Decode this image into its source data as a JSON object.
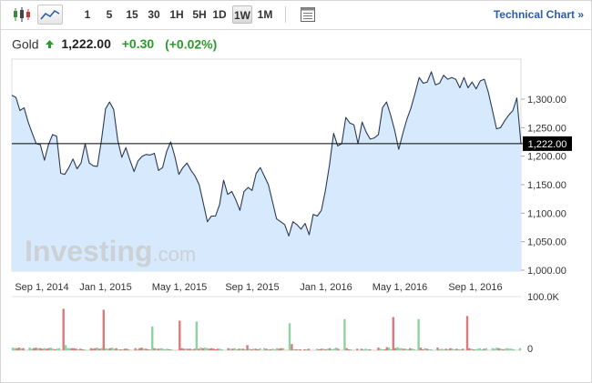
{
  "toolbar": {
    "chart_type_icons": [
      "candlestick-icon",
      "line-chart-icon"
    ],
    "timeframes": [
      {
        "label": "1",
        "active": false
      },
      {
        "label": "5",
        "active": false
      },
      {
        "label": "15",
        "active": false
      },
      {
        "label": "30",
        "active": false
      },
      {
        "label": "1H",
        "active": false
      },
      {
        "label": "5H",
        "active": false
      },
      {
        "label": "1D",
        "active": false
      },
      {
        "label": "1W",
        "active": true
      },
      {
        "label": "1M",
        "active": false
      }
    ],
    "table_icon": "table-icon",
    "technical_chart_label": "Technical Chart »"
  },
  "quote": {
    "name": "Gold",
    "direction_icon": "up-arrow-icon",
    "price": "1,222.00",
    "change": "+0.30",
    "change_pct": "(+0.02%)",
    "positive_color": "#2c9a2c"
  },
  "watermark": {
    "brand": "Investing",
    "suffix": ".com"
  },
  "colors": {
    "line": "#2b3a55",
    "area_fill": "#d7e9fc",
    "current_price_line": "#000000",
    "current_price_label_bg": "#000000",
    "volume_up": "#8fd0a5",
    "volume_down": "#d97b7b"
  },
  "chart_data": {
    "type": "area",
    "title": "",
    "xlabel": "",
    "ylabel": "",
    "x_tick_labels": [
      "Sep 1, 2014",
      "Jan 1, 2015",
      "May 1, 2015",
      "Sep 1, 2015",
      "Jan 1, 2016",
      "May 1, 2016",
      "Sep 1, 2016"
    ],
    "y_tick_labels": [
      "1,000.00",
      "1,050.00",
      "1,100.00",
      "1,150.00",
      "1,200.00",
      "1,250.00",
      "1,300.00"
    ],
    "ylim": [
      1000,
      1350
    ],
    "grid": false,
    "current_price": 1222,
    "current_price_label": "1,222.00",
    "series": [
      {
        "values": [
          1307,
          1303,
          1280,
          1285,
          1260,
          1240,
          1222,
          1220,
          1193,
          1220,
          1238,
          1235,
          1170,
          1168,
          1180,
          1195,
          1178,
          1188,
          1222,
          1188,
          1183,
          1182,
          1228,
          1283,
          1295,
          1282,
          1228,
          1198,
          1215,
          1193,
          1173,
          1192,
          1200,
          1203,
          1202,
          1205,
          1175,
          1180,
          1208,
          1225,
          1200,
          1168,
          1180,
          1188,
          1175,
          1165,
          1150,
          1118,
          1085,
          1095,
          1095,
          1115,
          1158,
          1133,
          1138,
          1123,
          1105,
          1138,
          1145,
          1140,
          1170,
          1180,
          1165,
          1150,
          1120,
          1090,
          1085,
          1080,
          1060,
          1085,
          1080,
          1072,
          1082,
          1062,
          1098,
          1095,
          1105,
          1140,
          1185,
          1240,
          1218,
          1222,
          1268,
          1258,
          1255,
          1222,
          1260,
          1242,
          1230,
          1232,
          1238,
          1285,
          1295,
          1272,
          1245,
          1212,
          1240,
          1265,
          1285,
          1310,
          1338,
          1328,
          1330,
          1348,
          1325,
          1328,
          1342,
          1335,
          1338,
          1335,
          1320,
          1338,
          1320,
          1330,
          1318,
          1332,
          1335,
          1312,
          1280,
          1248,
          1250,
          1262,
          1272,
          1280,
          1302,
          1222
        ]
      }
    ],
    "volume": {
      "axis_labels": [
        "100.0K",
        "0"
      ],
      "ylim": [
        0,
        100
      ],
      "values": [
        5,
        4,
        4,
        5,
        4,
        4,
        0,
        0,
        5,
        3,
        4,
        5,
        4,
        4,
        3,
        4,
        3,
        4,
        5,
        3,
        2,
        3,
        4,
        0,
        80,
        10,
        4,
        4,
        4,
        4,
        3,
        2,
        3,
        2,
        2,
        0,
        0,
        4,
        3,
        4,
        5,
        3,
        4,
        78,
        4,
        3,
        4,
        5,
        3,
        4,
        2,
        2,
        2,
        3,
        3,
        2,
        0,
        0,
        4,
        2,
        4,
        5,
        3,
        3,
        2,
        2,
        46,
        4,
        3,
        3,
        4,
        3,
        2,
        3,
        2,
        2,
        0,
        0,
        0,
        57,
        4,
        3,
        3,
        3,
        3,
        2,
        3,
        55,
        3,
        5,
        4,
        5,
        4,
        3,
        4,
        3,
        2,
        3,
        3,
        2,
        0,
        0,
        4,
        3,
        3,
        4,
        2,
        3,
        3,
        3,
        2,
        10,
        3,
        2,
        3,
        3,
        2,
        4,
        0,
        4,
        3,
        2,
        2,
        3,
        2,
        4,
        3,
        4,
        4,
        0,
        0,
        52,
        12,
        2,
        2,
        2,
        2,
        0,
        2,
        2,
        3,
        0,
        0,
        0,
        3,
        2,
        3,
        3,
        2,
        3,
        4,
        2,
        3,
        5,
        3,
        0,
        0,
        60,
        4,
        2,
        2,
        0,
        0,
        3,
        0,
        3,
        2,
        3,
        2,
        2,
        0,
        0,
        0,
        5,
        3,
        2,
        2,
        6,
        5,
        2,
        64,
        4,
        6,
        4,
        4,
        3,
        3,
        2,
        4,
        3,
        2,
        0,
        60,
        5,
        2,
        4,
        3,
        2,
        2,
        0,
        0,
        5,
        2,
        3,
        2,
        3,
        2,
        4,
        3,
        2,
        3,
        2,
        2,
        3,
        0,
        66,
        4,
        3,
        2,
        2,
        3,
        4,
        2,
        3,
        4,
        0,
        0,
        4,
        3,
        5,
        4,
        3,
        2,
        3,
        4,
        3,
        3,
        2,
        0,
        0,
        4
      ],
      "colors": [
        "g",
        "g",
        "r",
        "r",
        "g",
        "r",
        "g",
        "g",
        "g",
        "g",
        "r",
        "r",
        "g",
        "r",
        "r",
        "g",
        "r",
        "r",
        "g",
        "g",
        "r",
        "g",
        "g",
        "g",
        "r",
        "g",
        "g",
        "g",
        "r",
        "r",
        "r",
        "g",
        "r",
        "r",
        "g",
        "g",
        "g",
        "r",
        "r",
        "r",
        "g",
        "r",
        "g",
        "r",
        "g",
        "g",
        "r",
        "g",
        "g",
        "r",
        "g",
        "r",
        "g",
        "r",
        "r",
        "g",
        "g",
        "g",
        "r",
        "g",
        "r",
        "r",
        "g",
        "r",
        "r",
        "g",
        "g",
        "r",
        "g",
        "r",
        "g",
        "g",
        "g",
        "g",
        "r",
        "g",
        "r",
        "r",
        "g",
        "r",
        "r",
        "r",
        "g",
        "r",
        "r",
        "g",
        "r",
        "g",
        "r",
        "g",
        "r",
        "g",
        "g",
        "r",
        "r",
        "r",
        "r",
        "r",
        "g",
        "g",
        "g",
        "r",
        "r",
        "g",
        "r",
        "g",
        "g",
        "r",
        "g",
        "r",
        "g",
        "r",
        "g",
        "r",
        "g",
        "r",
        "r",
        "g",
        "r",
        "g",
        "r",
        "g",
        "r",
        "g",
        "g",
        "g",
        "r",
        "r",
        "g",
        "r",
        "g",
        "g",
        "r",
        "g",
        "r",
        "g",
        "r",
        "g",
        "r",
        "g",
        "r",
        "g",
        "g",
        "g",
        "g",
        "r",
        "r",
        "g",
        "r",
        "g",
        "r",
        "g",
        "g",
        "g",
        "r",
        "g",
        "r",
        "g",
        "r",
        "r",
        "g",
        "g",
        "g",
        "r",
        "g",
        "r",
        "g",
        "g",
        "g",
        "r",
        "g",
        "r",
        "g",
        "r",
        "g",
        "g",
        "r",
        "r",
        "g",
        "g",
        "r",
        "r",
        "g",
        "g",
        "g",
        "r",
        "g",
        "g",
        "r",
        "g",
        "g",
        "r",
        "g",
        "r",
        "r",
        "g",
        "r",
        "g",
        "g",
        "r",
        "g",
        "r",
        "g",
        "g",
        "g",
        "r",
        "g",
        "r",
        "g",
        "g",
        "r",
        "g",
        "g",
        "r",
        "g",
        "r",
        "r",
        "g",
        "r",
        "g",
        "g",
        "g",
        "g",
        "r",
        "g",
        "g",
        "r",
        "g",
        "g",
        "g",
        "r",
        "g",
        "r",
        "g",
        "g",
        "g"
      ]
    }
  }
}
